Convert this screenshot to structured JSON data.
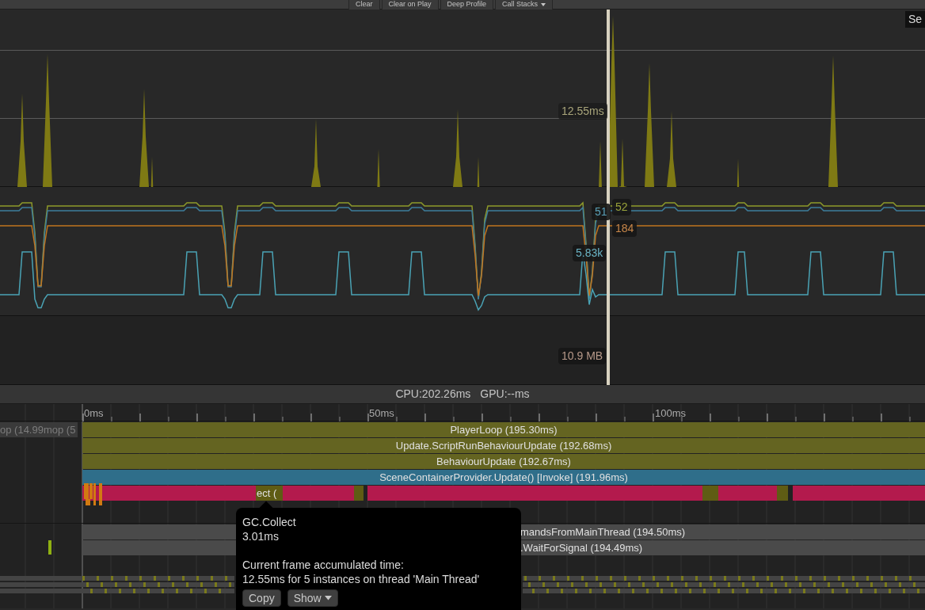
{
  "toolbar": {
    "buttons": [
      {
        "label": "Clear",
        "dropdown": false
      },
      {
        "label": "Clear on Play",
        "dropdown": false
      },
      {
        "label": "Deep Profile",
        "dropdown": false
      },
      {
        "label": "Call Stacks",
        "dropdown": true
      }
    ]
  },
  "cpu_chart": {
    "corner_label": "Se",
    "selected_value": "12.55ms"
  },
  "rendering_chart": {
    "values": [
      {
        "text": "51",
        "color": "#5aa0b8"
      },
      {
        "text": "52",
        "color": "#9aa23a"
      },
      {
        "text": "184",
        "color": "#c8874a"
      },
      {
        "text": "5.83k",
        "color": "#6ab3c4"
      }
    ]
  },
  "memory_chart": {
    "selected_value": "10.9 MB"
  },
  "summary": {
    "cpu": "CPU:202.26ms",
    "gpu": "GPU:--ms"
  },
  "timeline": {
    "ruler": [
      "0ms",
      "50ms",
      "100ms"
    ],
    "previous_frame": [
      "op (14.99m",
      "op (5"
    ],
    "main_thread": [
      {
        "label": "PlayerLoop (195.30ms)",
        "color": "#646421"
      },
      {
        "label": "Update.ScriptRunBehaviourUpdate (192.68ms)",
        "color": "#646421"
      },
      {
        "label": "BehaviourUpdate (192.67ms)",
        "color": "#646421"
      },
      {
        "label": "SceneContainerProvider.Update() [Invoke] (191.96ms)",
        "color": "#2f6e8a"
      }
    ],
    "selected_sample": "ect (",
    "render_thread": [
      "mandsFromMainThread (194.50ms)",
      ".WaitForSignal (194.49ms)"
    ]
  },
  "tooltip": {
    "name": "GC.Collect",
    "duration": "3.01ms",
    "heading": "Current frame accumulated time:",
    "detail": "12.55ms for 5 instances on thread 'Main Thread'",
    "buttons": [
      {
        "label": "Copy",
        "dropdown": false
      },
      {
        "label": "Show",
        "dropdown": true
      }
    ]
  }
}
